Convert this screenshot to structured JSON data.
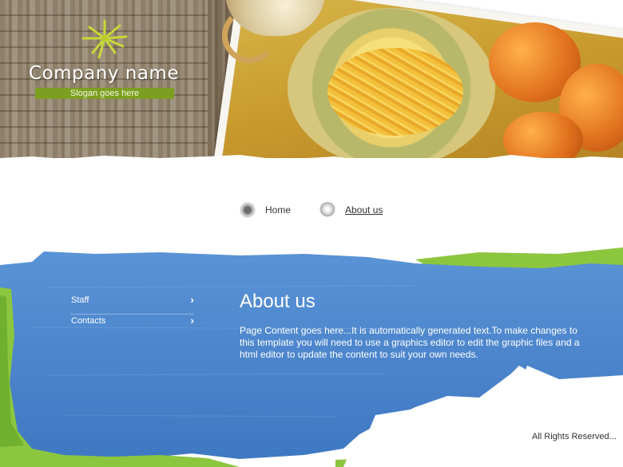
{
  "header": {
    "company_name": "Company name",
    "slogan": "Slogan goes here",
    "logo_icon": "sun-icon"
  },
  "nav": {
    "items": [
      {
        "label": "Home",
        "icon": "bullet-icon",
        "active": false
      },
      {
        "label": "About us",
        "icon": "bullet-icon",
        "active": true
      }
    ]
  },
  "sidebar": {
    "items": [
      {
        "label": "Staff",
        "icon": "double-chevron-right-icon"
      },
      {
        "label": "Contacts",
        "icon": "double-chevron-right-icon"
      }
    ]
  },
  "main": {
    "title": "About us",
    "body": "Page Content goes here...It is automatically generated text.To make changes to this template you will need to use a graphics editor to edit the graphic files and a html editor to update the content to suit your own needs."
  },
  "footer": {
    "text": "All Rights Reserved..."
  },
  "colors": {
    "blue": "#4a86cf",
    "green": "#8cc63f",
    "slogan_bg": "#7c9f22"
  }
}
